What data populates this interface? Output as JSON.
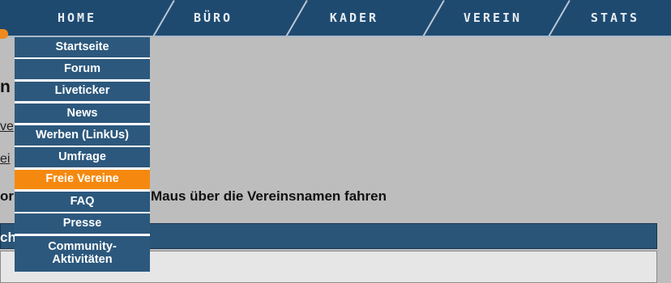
{
  "topnav": {
    "tabs": [
      "HOME",
      "BÜRO",
      "KADER",
      "VEREIN",
      "STATS"
    ]
  },
  "dropdown": {
    "items": [
      {
        "label": "Startseite"
      },
      {
        "label": "Forum"
      },
      {
        "label": "Liveticker"
      },
      {
        "label": "News"
      },
      {
        "label": "Werben (LinkUs)"
      },
      {
        "label": "Umfrage"
      },
      {
        "label": "Freie Vereine",
        "active": true
      },
      {
        "label": "FAQ"
      },
      {
        "label": "Presse"
      },
      {
        "label": "Community-\nAktivitäten"
      }
    ]
  },
  "page": {
    "heading_fragment": "n",
    "link1_fragment": "ve",
    "link2_fragment": "ei",
    "bold_fragment": "or",
    "instruction": "Maus über die Vereinsnamen fahren",
    "panel_heading_fragment": "ch"
  },
  "colors": {
    "nav_bg": "#1f4a70",
    "menu_item_bg": "#2c587d",
    "menu_active_bg": "#f5890f",
    "page_bg": "#bdbdbd"
  }
}
